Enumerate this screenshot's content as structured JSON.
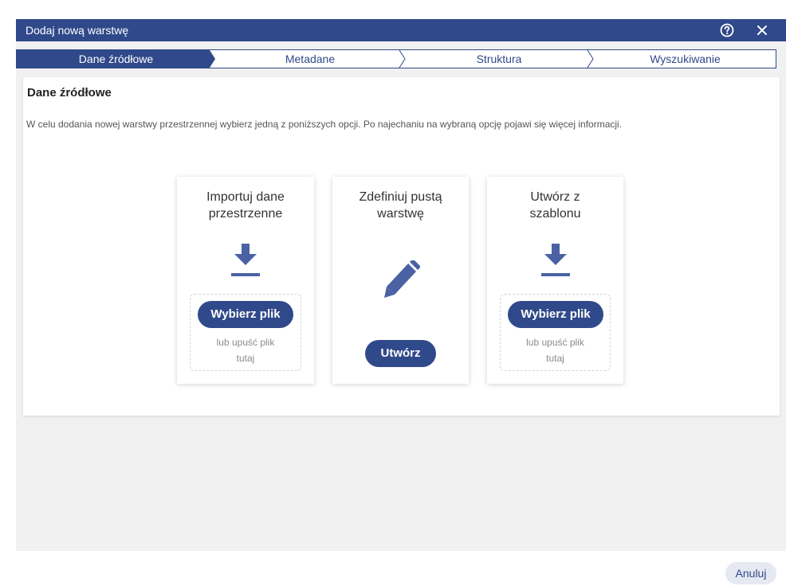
{
  "dialog": {
    "title": "Dodaj nową warstwę",
    "help_icon": "help-circle-icon",
    "close_icon": "close-icon"
  },
  "stepper": {
    "steps": [
      {
        "label": "Dane źródłowe",
        "active": true
      },
      {
        "label": "Metadane",
        "active": false
      },
      {
        "label": "Struktura",
        "active": false
      },
      {
        "label": "Wyszukiwanie",
        "active": false
      }
    ]
  },
  "panel": {
    "title": "Dane źródłowe",
    "description": "W celu dodania nowej warstwy przestrzennej wybierz jedną z poniższych opcji. Po najechaniu na wybraną opcję pojawi się więcej informacji."
  },
  "options": [
    {
      "title_line1": "Importuj dane",
      "title_line2": "przestrzenne",
      "icon": "download-icon",
      "button": "Wybierz plik",
      "hint_line1": "lub upuść plik",
      "hint_line2": "tutaj"
    },
    {
      "title_line1": "Zdefiniuj pustą",
      "title_line2": "warstwę",
      "icon": "pencil-icon",
      "button": "Utwórz"
    },
    {
      "title_line1": "Utwórz z",
      "title_line2": "szablonu",
      "icon": "download-icon",
      "button": "Wybierz plik",
      "hint_line1": "lub upuść plik",
      "hint_line2": "tutaj"
    }
  ],
  "footer": {
    "cancel": "Anuluj"
  },
  "colors": {
    "primary": "#30498a",
    "accent_light": "#e6e9f2",
    "background": "#f1f1f2"
  }
}
